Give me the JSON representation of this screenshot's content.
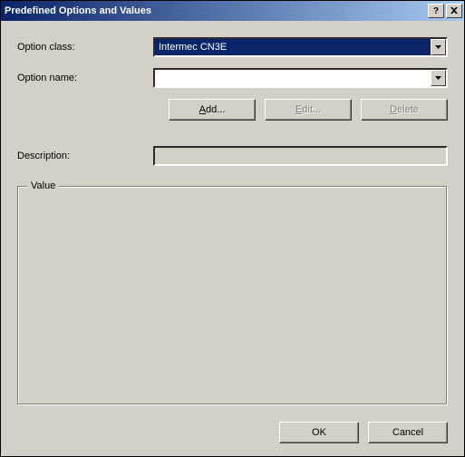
{
  "titlebar": {
    "title": "Predefined Options and Values"
  },
  "labels": {
    "optionClass": "Option class:",
    "optionName": "Option name:",
    "description": "Description:"
  },
  "fields": {
    "optionClassValue": "Intermec CN3E",
    "optionNameValue": "",
    "descriptionValue": ""
  },
  "buttons": {
    "addPrefix": "A",
    "addSuffix": "dd...",
    "editPrefix": "E",
    "editSuffix": "dit...",
    "deletePrefix": "D",
    "deleteSuffix": "elete",
    "ok": "OK",
    "cancel": "Cancel"
  },
  "fieldset": {
    "legend": "Value"
  }
}
